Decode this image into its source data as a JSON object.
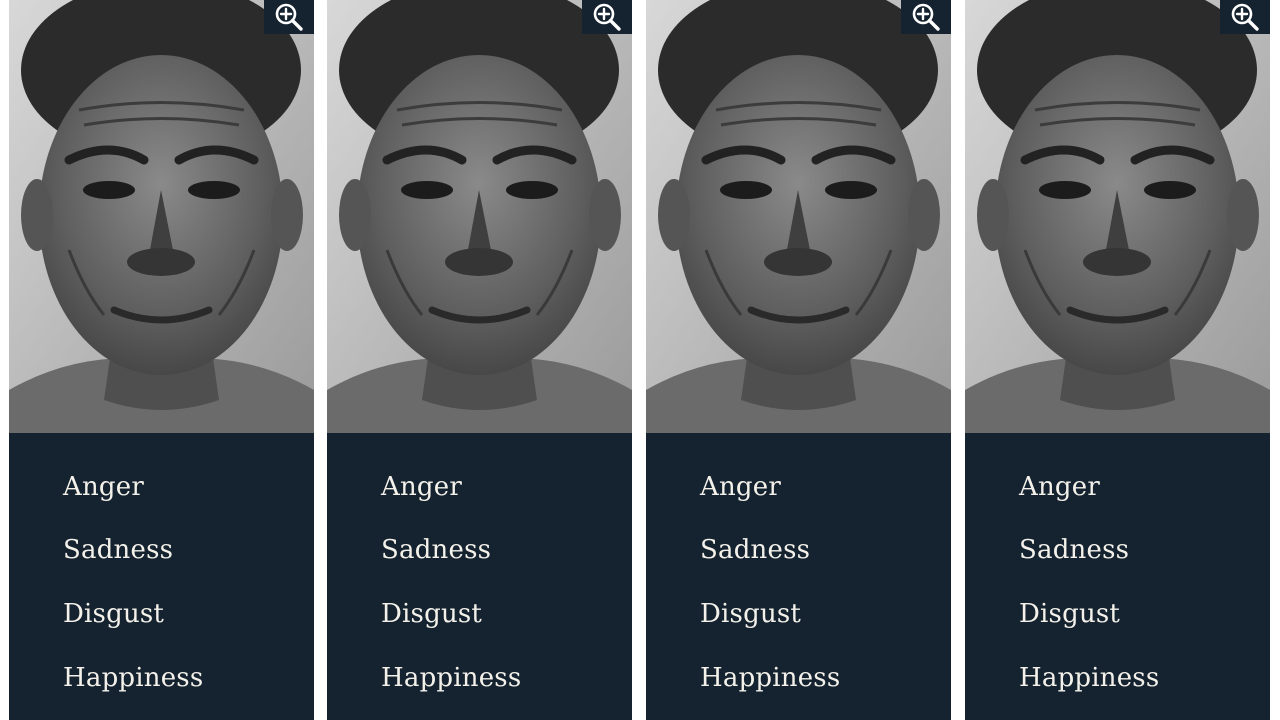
{
  "colors": {
    "panel": "#152330",
    "option_text": "#f3f1ea",
    "background": "#ffffff"
  },
  "cards": [
    {
      "photo_icon": "zoom-in-icon",
      "options": [
        "Anger",
        "Sadness",
        "Disgust",
        "Happiness"
      ]
    },
    {
      "photo_icon": "zoom-in-icon",
      "options": [
        "Anger",
        "Sadness",
        "Disgust",
        "Happiness"
      ]
    },
    {
      "photo_icon": "zoom-in-icon",
      "options": [
        "Anger",
        "Sadness",
        "Disgust",
        "Happiness"
      ]
    },
    {
      "photo_icon": "zoom-in-icon",
      "options": [
        "Anger",
        "Sadness",
        "Disgust",
        "Happiness"
      ]
    }
  ]
}
